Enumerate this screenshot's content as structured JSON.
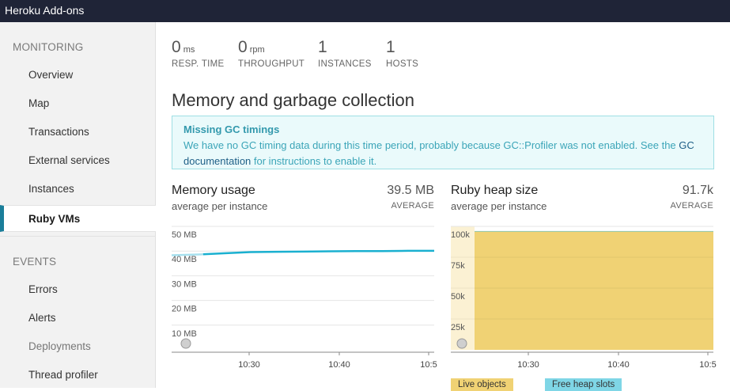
{
  "app": {
    "title": "Heroku Add-ons"
  },
  "sidebar": {
    "monitoring_title": "MONITORING",
    "monitoring_items": [
      {
        "label": "Overview",
        "active": false
      },
      {
        "label": "Map",
        "active": false
      },
      {
        "label": "Transactions",
        "active": false
      },
      {
        "label": "External services",
        "active": false
      },
      {
        "label": "Instances",
        "active": false
      },
      {
        "label": "Ruby VMs",
        "active": true
      }
    ],
    "events_title": "EVENTS",
    "events_items": [
      {
        "label": "Errors"
      },
      {
        "label": "Alerts"
      },
      {
        "label": "Deployments"
      },
      {
        "label": "Thread profiler"
      }
    ]
  },
  "metrics": [
    {
      "value": "0",
      "unit": "ms",
      "label": "RESP. TIME"
    },
    {
      "value": "0",
      "unit": "rpm",
      "label": "THROUGHPUT"
    },
    {
      "value": "1",
      "unit": "",
      "label": "INSTANCES"
    },
    {
      "value": "1",
      "unit": "",
      "label": "HOSTS"
    }
  ],
  "section_heading": "Memory and garbage collection",
  "alert": {
    "title": "Missing GC timings",
    "text_before": "We have no GC timing data during this time period, probably because GC::Profiler was not enabled. See the ",
    "link": "GC documentation",
    "text_after": " for instructions to enable it."
  },
  "colors": {
    "line": "#1ab0d0",
    "heap_fill": "#f0d274",
    "heap_light": "#fbf1d3",
    "legend_free": "#7fd6e6"
  },
  "chart_data": [
    {
      "type": "line",
      "title": "Memory usage",
      "subtitle": "average per instance",
      "summary_value": "39.5 MB",
      "summary_label": "AVERAGE",
      "y_ticks": [
        "50 MB",
        "40 MB",
        "30 MB",
        "20 MB",
        "10 MB"
      ],
      "ylim": [
        0,
        50
      ],
      "x_ticks": [
        "10:30",
        "10:40",
        "10:5"
      ],
      "series": [
        {
          "x": [
            0,
            0.12,
            0.2,
            0.3,
            0.4,
            0.5,
            0.6,
            0.7,
            0.8,
            0.9,
            1.0
          ],
          "y": [
            38.3,
            38.7,
            39.1,
            39.6,
            39.7,
            39.8,
            39.9,
            40.0,
            40.0,
            40.1,
            40.1
          ]
        }
      ],
      "grid": true
    },
    {
      "type": "area",
      "title": "Ruby heap size",
      "subtitle": "average per instance",
      "summary_value": "91.7k",
      "summary_label": "AVERAGE",
      "y_ticks": [
        "100k",
        "75k",
        "50k",
        "25k"
      ],
      "ylim": [
        0,
        100
      ],
      "x_ticks": [
        "10:30",
        "10:40",
        "10:5"
      ],
      "series": [
        {
          "name": "Live objects",
          "value": 95.9
        },
        {
          "name": "Free heap slots",
          "value": 0.3
        }
      ],
      "grid": true
    }
  ]
}
